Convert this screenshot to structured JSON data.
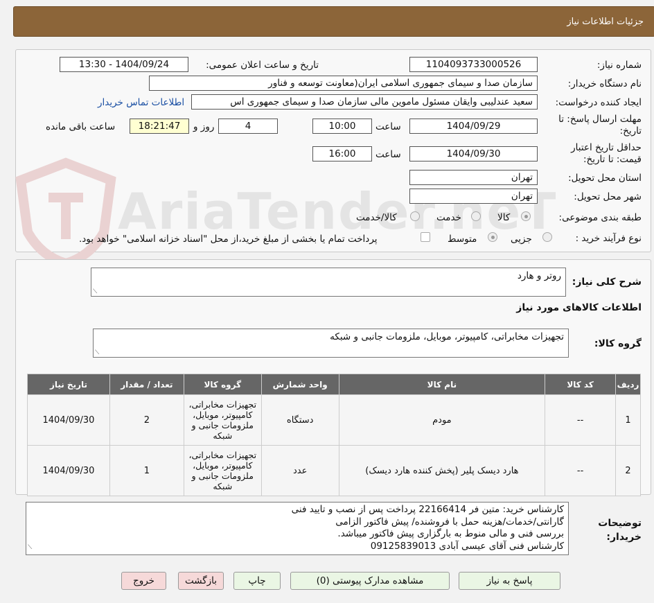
{
  "header": {
    "title": "جزئیات اطلاعات نیاز"
  },
  "form": {
    "need_number_label": "شماره نیاز:",
    "need_number": "1104093733000526",
    "announce_label": "تاریخ و ساعت اعلان عمومی:",
    "announce_value": "1404/09/24 - 13:30",
    "buyer_org_label": "نام دستگاه خریدار:",
    "buyer_org": "سازمان صدا و سیمای جمهوری اسلامی ایران(معاونت توسعه و فناور",
    "requester_label": "ایجاد کننده درخواست:",
    "requester": "سعید عندلیبی وایقان مسئول ماموین مالی  سازمان صدا و سیمای جمهوری اس",
    "contact_link": "اطلاعات تماس خریدار",
    "deadline_label": "مهلت ارسال پاسخ: تا تاریخ:",
    "deadline_date": "1404/09/29",
    "time_label": "ساعت",
    "deadline_time": "10:00",
    "days_value": "4",
    "days_label": "روز و",
    "remaining_time": "18:21:47",
    "remaining_label": "ساعت باقی مانده",
    "validity_label": "حداقل تاریخ اعتبار قیمت: تا تاریخ:",
    "validity_date": "1404/09/30",
    "validity_time_label": "ساعت",
    "validity_time": "16:00",
    "province_label": "استان محل تحویل:",
    "province": "تهران",
    "city_label": "شهر محل تحویل:",
    "city": "تهران",
    "category_label": "طبقه بندی موضوعی:",
    "category_options": [
      "کالا",
      "خدمت",
      "کالا/خدمت"
    ],
    "process_label": "نوع فرآیند خرید :",
    "process_options": [
      "جزیی",
      "متوسط"
    ],
    "payment_note": "پرداخت تمام یا بخشی از مبلغ خرید،از محل \"اسناد خزانه اسلامی\" خواهد بود."
  },
  "summary": {
    "label": "شرح کلی نیاز:",
    "value": "روتر و هارد",
    "goods_info_title": "اطلاعات کالاهای مورد نیاز",
    "group_label": "گروه کالا:",
    "group_value": "تجهیزات مخابراتی، کامپیوتر، موبایل، ملزومات جانبی و شبکه"
  },
  "table": {
    "headers": [
      "ردیف",
      "کد کالا",
      "نام کالا",
      "واحد شمارش",
      "گروه کالا",
      "تعداد / مقدار",
      "تاریخ نیاز"
    ],
    "rows": [
      [
        "1",
        "--",
        "مودم",
        "دستگاه",
        "تجهیزات مخابراتی، کامپیوتر، موبایل، ملزومات جانبی و شبکه",
        "2",
        "1404/09/30"
      ],
      [
        "2",
        "--",
        "هارد دیسک پلیر (پخش کننده هارد دیسک)",
        "عدد",
        "تجهیزات مخابراتی، کامپیوتر، موبایل، ملزومات جانبی و شبکه",
        "1",
        "1404/09/30"
      ]
    ]
  },
  "notes": {
    "label": "توضیحات خریدار:",
    "lines": [
      "کارشناس خرید: متین فر 22166414    پرداخت پس از نصب و تایید فنی",
      "گارانتی/خدمات/هزینه حمل با فروشنده/ پیش فاکتور الزامی",
      "بررسی فنی و مالی منوط به بارگزاری پیش فاکتور میباشد.",
      "کارشناس فنی آقای عیسی آبادی 09125839013"
    ]
  },
  "buttons": {
    "reply": "پاسخ به نیاز",
    "attachments": "مشاهده مدارک پیوستی (0)",
    "print": "چاپ",
    "back": "بازگشت",
    "exit": "خروج"
  },
  "watermark": {
    "text": "AriaTender.neT"
  },
  "colors": {
    "header": "#8c6539",
    "table_header": "#666666",
    "link": "#1a4fa3",
    "remaining_bg": "#ffffd2"
  }
}
